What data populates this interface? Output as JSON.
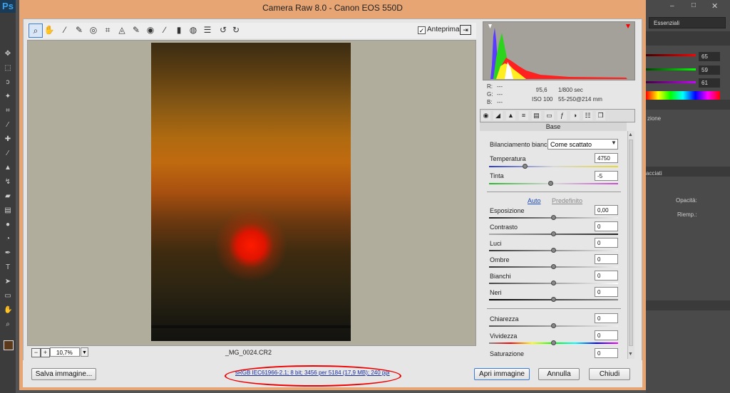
{
  "app": {
    "name": "Ps"
  },
  "window": {
    "title": "Camera Raw 8.0  -  Canon EOS 550D"
  },
  "photoshop": {
    "workspace": "Essenziali",
    "color_values": [
      "65",
      "59",
      "61"
    ],
    "panel_labels": [
      "zione",
      "acciati"
    ],
    "opacity_label": "Opacità:",
    "fill_label": "Riemp.:"
  },
  "toolbar": {
    "preview_label": "Anteprima",
    "preview_checked": "✓"
  },
  "zoom": {
    "value": "10,7%"
  },
  "file": {
    "name": "_MG_0024.CR2"
  },
  "info": {
    "r_label": "R:",
    "g_label": "G:",
    "b_label": "B:",
    "r_val": "---",
    "g_val": "---",
    "b_val": "---",
    "aperture": "f/5,6",
    "shutter": "1/800 sec",
    "iso": "ISO 100",
    "lens": "55-250@214 mm"
  },
  "panel": {
    "title": "Base",
    "wb_label": "Bilanciamento bianco:",
    "wb_value": "Come scattato",
    "auto": "Auto",
    "default": "Predefinito",
    "sliders": [
      {
        "label": "Temperatura",
        "value": "4750"
      },
      {
        "label": "Tinta",
        "value": "-5"
      },
      {
        "label": "Esposizione",
        "value": "0,00"
      },
      {
        "label": "Contrasto",
        "value": "0"
      },
      {
        "label": "Luci",
        "value": "0"
      },
      {
        "label": "Ombre",
        "value": "0"
      },
      {
        "label": "Bianchi",
        "value": "0"
      },
      {
        "label": "Neri",
        "value": "0"
      },
      {
        "label": "Chiarezza",
        "value": "0"
      },
      {
        "label": "Vividezza",
        "value": "0"
      },
      {
        "label": "Saturazione",
        "value": "0"
      }
    ]
  },
  "footer": {
    "save": "Salva immagine...",
    "workflow": "sRGB IEC61966-2.1; 8 bit; 3456 per 5184 (17,9 MB); 240 ppi",
    "open": "Apri immagine",
    "cancel": "Annulla",
    "close": "Chiudi"
  },
  "colors": {
    "dialog_frame": "#e8a574",
    "annotation": "#e00000",
    "link": "#1a2f9c"
  }
}
